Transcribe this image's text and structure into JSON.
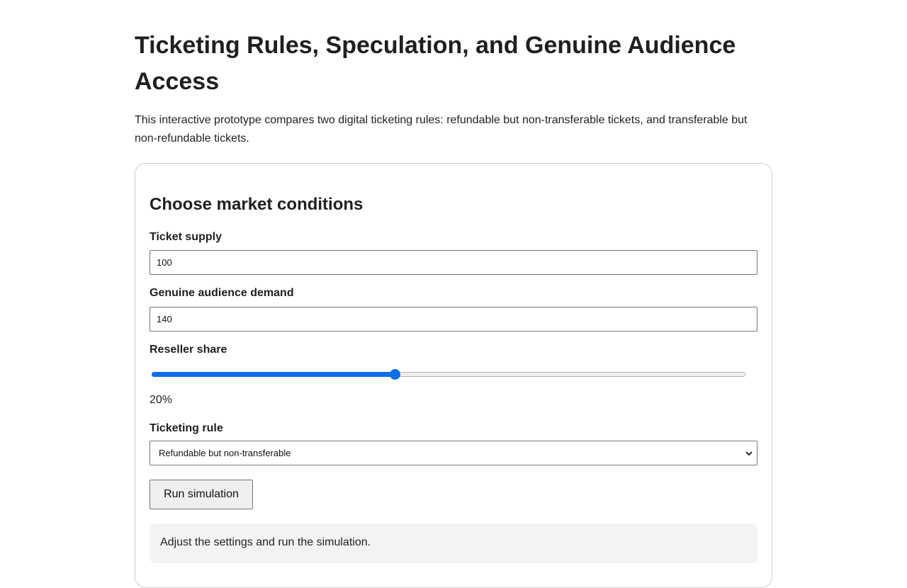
{
  "page": {
    "title": "Ticketing Rules, Speculation, and Genuine Audience Access",
    "intro": "This interactive prototype compares two digital ticketing rules: refundable but non-transferable tickets, and transferable but non-refundable tickets."
  },
  "controls": {
    "heading": "Choose market conditions",
    "supply": {
      "label": "Ticket supply",
      "value": "100"
    },
    "demand": {
      "label": "Genuine audience demand",
      "value": "140"
    },
    "reseller_share": {
      "label": "Reseller share",
      "value_text": "20%",
      "slider_fraction": 0.4
    },
    "rule": {
      "label": "Ticketing rule",
      "selected": "Refundable but non-transferable"
    },
    "run_button": "Run simulation"
  },
  "status": {
    "message": "Adjust the settings and run the simulation."
  },
  "colors": {
    "accent": "#0a6ee6",
    "status_bg": "#f3f3f3",
    "border": "#cfcfcf"
  }
}
